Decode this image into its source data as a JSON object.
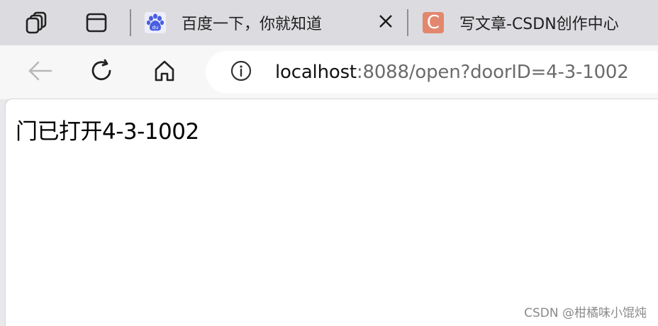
{
  "tabs": [
    {
      "title": "百度一下，你就知道",
      "favicon": "baidu-paw-icon",
      "active": false,
      "close_glyph": "✕"
    },
    {
      "title": "写文章-CSDN创作中心",
      "favicon": "csdn-c-icon",
      "favicon_letter": "C",
      "active": false
    }
  ],
  "toolbar": {
    "icons": [
      "back-icon",
      "reload-icon",
      "home-icon"
    ]
  },
  "address_bar": {
    "host": "localhost",
    "rest": ":8088/open?doorID=4-3-1002",
    "site_info_icon": "info-icon"
  },
  "page": {
    "message": "门已打开4-3-1002"
  },
  "watermark": "CSDN @柑橘味小馄炖",
  "colors": {
    "tabstrip": "#dcdce0",
    "toolbar": "#f7f7f7",
    "csdn_favicon": "#e2876e",
    "baidu_favicon": "#4a5ee0"
  }
}
